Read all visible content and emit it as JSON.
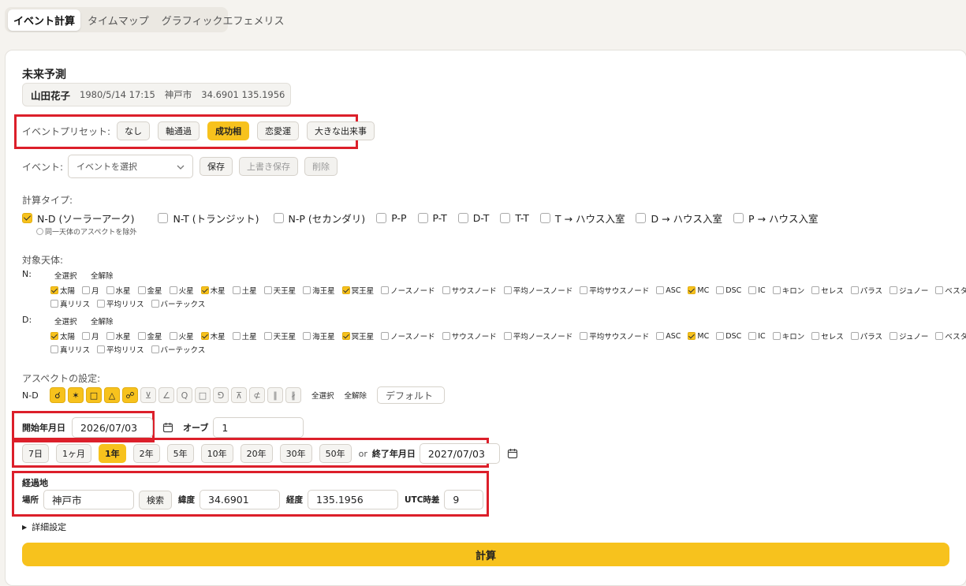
{
  "tabs": [
    "イベント計算",
    "タイムマップ",
    "グラフィックエフェメリス"
  ],
  "title": "未来予測",
  "person": {
    "name": "山田花子",
    "datetime": "1980/5/14 17:15",
    "place": "神戸市",
    "coords": "34.6901 135.1956"
  },
  "presets": {
    "label": "イベントプリセット:",
    "items": [
      "なし",
      "軸通過",
      "成功相",
      "恋愛運",
      "大きな出来事"
    ],
    "active": 2
  },
  "event": {
    "label": "イベント:",
    "placeholder": "イベントを選択",
    "save": "保存",
    "overwrite": "上書き保存",
    "delete": "削除"
  },
  "calc_type": {
    "label": "計算タイプ:",
    "items": [
      {
        "label": "N-D (ソーラーアーク)",
        "checked": true
      },
      {
        "label": "N-T (トランジット)",
        "checked": false
      },
      {
        "label": "N-P (セカンダリ)",
        "checked": false
      },
      {
        "label": "P-P",
        "checked": false
      },
      {
        "label": "P-T",
        "checked": false
      },
      {
        "label": "D-T",
        "checked": false
      },
      {
        "label": "T-T",
        "checked": false
      },
      {
        "label": "T → ハウス入室",
        "checked": false
      },
      {
        "label": "D → ハウス入室",
        "checked": false
      },
      {
        "label": "P → ハウス入室",
        "checked": false
      }
    ],
    "exclude_label": "同一天体のアスペクトを除外"
  },
  "bodies": {
    "label": "対象天体:",
    "select_all": "全選択",
    "deselect_all": "全解除",
    "groups": [
      {
        "name": "N:",
        "checked": [
          "太陽",
          "木星",
          "冥王星",
          "MC"
        ]
      },
      {
        "name": "D:",
        "checked": [
          "太陽",
          "木星",
          "冥王星",
          "MC"
        ]
      }
    ],
    "list": [
      "太陽",
      "月",
      "水星",
      "金星",
      "火星",
      "木星",
      "土星",
      "天王星",
      "海王星",
      "冥王星",
      "ノースノード",
      "サウスノード",
      "平均ノースノード",
      "平均サウスノード",
      "ASC",
      "MC",
      "DSC",
      "IC",
      "キロン",
      "セレス",
      "パラス",
      "ジュノー",
      "ベスタ",
      "真リリス",
      "平均リリス",
      "バーテックス"
    ]
  },
  "aspects": {
    "label": "アスペクトの設定:",
    "row_label": "N-D",
    "symbols": [
      "☌",
      "✶",
      "□",
      "△",
      "☍",
      "⊻",
      "∠",
      "Q",
      "□",
      "⅁",
      "⊼",
      "⊄",
      "∥",
      "∦"
    ],
    "on": [
      0,
      1,
      2,
      3,
      4
    ],
    "select_all": "全選択",
    "deselect_all": "全解除",
    "preset_value": "デフォルト"
  },
  "start": {
    "label": "開始年月日",
    "value": "2026/07/03",
    "orb_label": "オーブ",
    "orb_value": "1"
  },
  "durations": {
    "items": [
      "7日",
      "1ヶ月",
      "1年",
      "2年",
      "5年",
      "10年",
      "20年",
      "30年",
      "50年"
    ],
    "active": 2,
    "or": "or",
    "end_label": "終了年月日",
    "end_value": "2027/07/03"
  },
  "location": {
    "title": "経過地",
    "place_label": "場所",
    "place_value": "神戸市",
    "search": "検索",
    "lat_label": "緯度",
    "lat_value": "34.6901",
    "lon_label": "経度",
    "lon_value": "135.1956",
    "utc_label": "UTC時差",
    "utc_value": "9"
  },
  "details": "詳細設定",
  "calculate": "計算",
  "colors": {
    "accent": "#f7c21d",
    "highlight": "#dc1f2a"
  }
}
